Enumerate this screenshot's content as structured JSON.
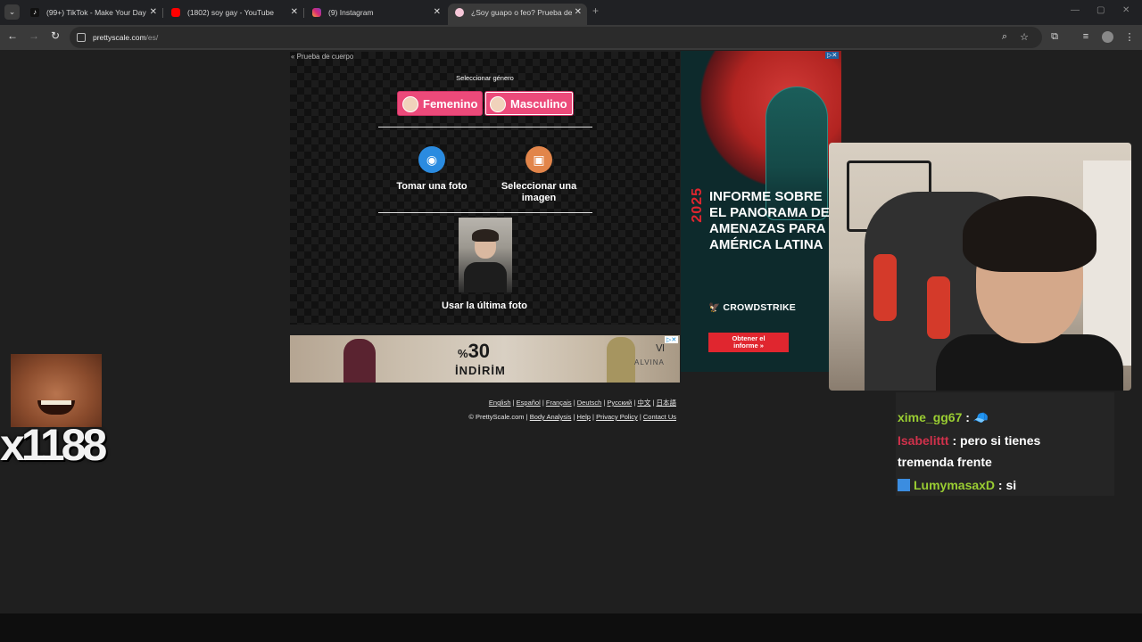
{
  "browser": {
    "tabs": [
      {
        "title": "(99+) TikTok - Make Your Day",
        "icon": "tiktok-icon",
        "close": "✕"
      },
      {
        "title": "(1802) soy gay - YouTube",
        "icon": "youtube-icon",
        "close": "✕"
      },
      {
        "title": "(9) Instagram",
        "icon": "instagram-icon",
        "close": "✕"
      },
      {
        "title": "¿Soy guapo o feo? Prueba de a",
        "icon": "prettyscale-icon",
        "close": "✕",
        "active": true
      }
    ],
    "url_host": "prettyscale.com",
    "url_path": "/es/"
  },
  "app": {
    "back_link": "« Prueba de cuerpo",
    "gender_label": "Seleccionar género",
    "female_button": "Femenino",
    "male_button": "Masculino",
    "selected_gender": "Masculino",
    "take_photo": "Tomar una foto",
    "select_image_line1": "Seleccionar una",
    "select_image_line2": "imagen",
    "use_last_photo": "Usar la última foto"
  },
  "banner_ad": {
    "percent_symbol": "%",
    "percent": "30",
    "indirim": "İNDİRİM",
    "brand": "ALVINA"
  },
  "footer": {
    "languages": [
      "English",
      "Español",
      "Français",
      "Deutsch",
      "Pусский",
      "中文",
      "日本語"
    ],
    "copyright": "© PrettyScale.com",
    "links": [
      "Body Analysis",
      "Help",
      "Privacy Policy",
      "Contact Us"
    ]
  },
  "side_ad": {
    "year": "2025",
    "headline": "INFORME SOBRE EL PANORAMA DE AMENAZAS PARA AMÉRICA LATINA",
    "logo": "CROWDSTRIKE",
    "cta_line1": "Obtener el",
    "cta_line2": "informe »"
  },
  "stream_overlay": {
    "emote_count": "x1188",
    "chat": [
      {
        "user": "xime_gg67",
        "message": "🧢"
      },
      {
        "user": "Isabelittt",
        "message": "pero si tienes"
      },
      {
        "user": "",
        "message": "tremenda frente"
      },
      {
        "user": "LumymasaxD",
        "message": "si"
      }
    ]
  },
  "colors": {
    "accent_pink": "#ec4a7a",
    "camera_blue": "#2a8be0",
    "image_orange": "#e2854a",
    "crowdstrike_red": "#e0262f"
  }
}
